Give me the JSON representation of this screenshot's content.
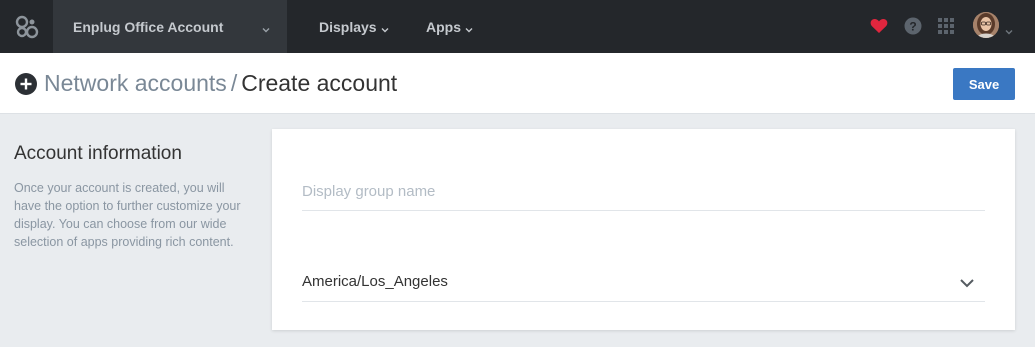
{
  "nav": {
    "account_name": "Enplug Office Account",
    "links": [
      {
        "label": "Displays"
      },
      {
        "label": "Apps"
      }
    ],
    "icons": [
      "logo-icon",
      "heart-icon",
      "help-icon",
      "apps-grid-icon",
      "avatar"
    ],
    "accent": "#e0263e"
  },
  "header": {
    "breadcrumb_link": "Network accounts",
    "breadcrumb_separator": "/",
    "breadcrumb_current": "Create account",
    "save_label": "Save",
    "save_color": "#3a78c3"
  },
  "info": {
    "title": "Account information",
    "description": "Once your account is created, you will have the option to further customize your display. You can choose from our wide selection of apps providing rich content."
  },
  "form": {
    "name_placeholder": "Display group name",
    "name_value": "",
    "timezone_value": "America/Los_Angeles"
  }
}
